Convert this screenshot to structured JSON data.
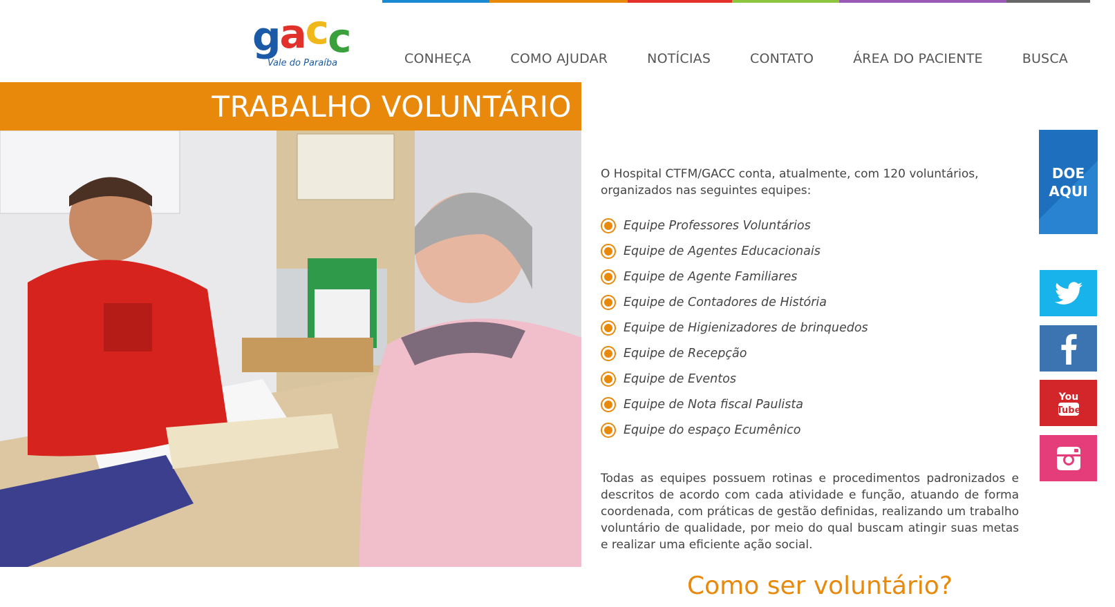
{
  "colors": {
    "accent_orange": "#e8890c",
    "strip": [
      "#1a8bd2",
      "#e8890c",
      "#e2312b",
      "#8cc63f",
      "#9b59b6",
      "#666666"
    ]
  },
  "logo": {
    "letters": [
      "g",
      "a",
      "c",
      "c"
    ],
    "subtitle": "Vale do Paraíba"
  },
  "nav": {
    "items": [
      "CONHEÇA",
      "COMO AJUDAR",
      "NOTÍCIAS",
      "CONTATO",
      "ÁREA DO PACIENTE",
      "BUSCA"
    ]
  },
  "page": {
    "title": "TRABALHO VOLUNTÁRIO",
    "intro": "O Hospital CTFM/GACC conta, atualmente, com 120 voluntários, organizados nas seguintes equipes:",
    "teams": [
      "Equipe Professores Voluntários",
      "Equipe de Agentes Educacionais",
      "Equipe de Agente Familiares",
      "Equipe de Contadores de História",
      "Equipe de Higienizadores de brinquedos",
      "Equipe de Recepção",
      "Equipe de Eventos",
      "Equipe de Nota fiscal Paulista",
      "Equipe do espaço Ecumênico"
    ],
    "description": "Todas as equipes possuem rotinas e procedimentos padronizados e descritos de acordo com cada atividade e função, atuando de forma coordenada, com práticas de gestão definidas, realizando um trabalho voluntário de qualidade, por meio do qual buscam atingir suas metas e realizar uma eficiente ação social.",
    "subheading": "Como ser voluntário?"
  },
  "sidebar": {
    "donate_line1": "DOE",
    "donate_line2": "AQUI",
    "youtube_line1": "You",
    "youtube_line2": "Tube"
  }
}
